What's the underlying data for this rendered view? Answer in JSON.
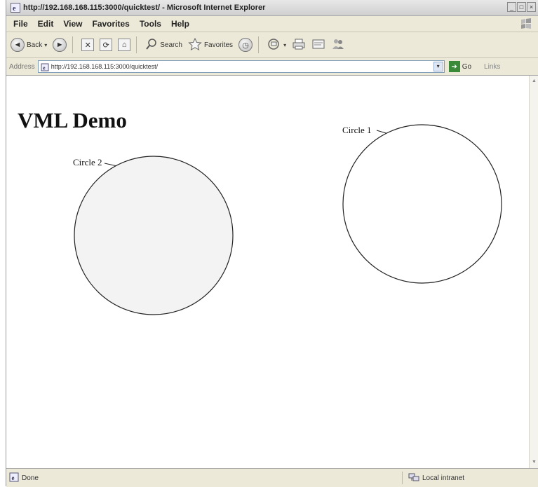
{
  "window": {
    "title": "http://192.168.168.115:3000/quicktest/ - Microsoft Internet Explorer",
    "controls": [
      "_",
      "□",
      "×"
    ]
  },
  "menu": {
    "items": [
      "File",
      "Edit",
      "View",
      "Favorites",
      "Tools",
      "Help"
    ]
  },
  "toolbar": {
    "back_label": "Back",
    "search_label": "Search",
    "favorites_label": "Favorites"
  },
  "address": {
    "label": "Address",
    "url": "http://192.168.168.115:3000/quicktest/",
    "go_label": "Go",
    "links_label": "Links"
  },
  "page": {
    "heading": "VML Demo",
    "circles": [
      {
        "label": "Circle 1",
        "fill": "#ffffff"
      },
      {
        "label": "Circle 2",
        "fill": "#f3f3f3"
      }
    ]
  },
  "status": {
    "left_text": "Done",
    "zone_text": "Local intranet"
  },
  "icons": {
    "ie": "ie-logo-icon",
    "throbber": "windows-throbber-icon"
  }
}
